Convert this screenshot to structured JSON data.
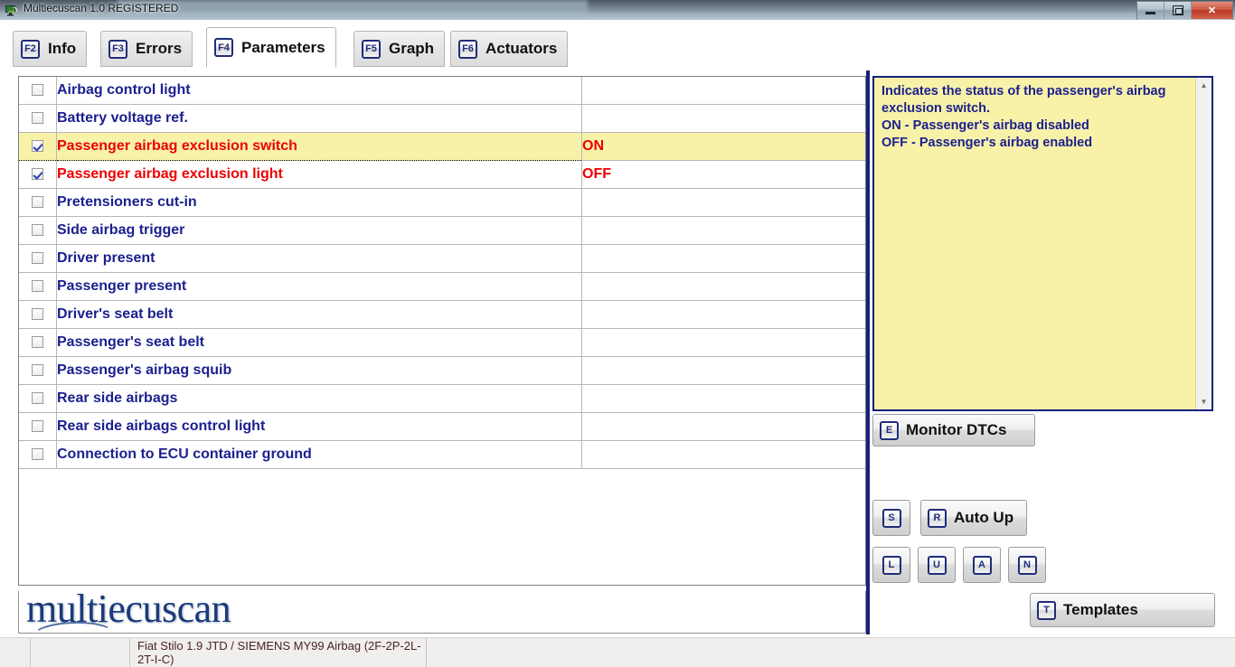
{
  "window": {
    "title": "Multiecuscan 1.0 REGISTERED",
    "app_icon": "car-scanner-icon",
    "minimize_label": "–",
    "restore_label": "❐",
    "close_label": "✕"
  },
  "tabs": [
    {
      "key": "F2",
      "label": "Info",
      "active": false
    },
    {
      "key": "F3",
      "label": "Errors",
      "active": false
    },
    {
      "key": "F4",
      "label": "Parameters",
      "active": true
    },
    {
      "key": "F5",
      "label": "Graph",
      "active": false
    },
    {
      "key": "F6",
      "label": "Actuators",
      "active": false
    }
  ],
  "grid": {
    "rows": [
      {
        "checked": false,
        "selected": false,
        "alert": false,
        "name": "Airbag control light",
        "value": ""
      },
      {
        "checked": false,
        "selected": false,
        "alert": false,
        "name": "Battery voltage ref.",
        "value": ""
      },
      {
        "checked": true,
        "selected": true,
        "alert": true,
        "name": "Passenger airbag exclusion switch",
        "value": "ON"
      },
      {
        "checked": true,
        "selected": false,
        "alert": true,
        "name": "Passenger airbag exclusion light",
        "value": "OFF"
      },
      {
        "checked": false,
        "selected": false,
        "alert": false,
        "name": "Pretensioners cut-in",
        "value": ""
      },
      {
        "checked": false,
        "selected": false,
        "alert": false,
        "name": "Side airbag trigger",
        "value": ""
      },
      {
        "checked": false,
        "selected": false,
        "alert": false,
        "name": "Driver present",
        "value": ""
      },
      {
        "checked": false,
        "selected": false,
        "alert": false,
        "name": "Passenger present",
        "value": ""
      },
      {
        "checked": false,
        "selected": false,
        "alert": false,
        "name": "Driver's seat belt",
        "value": ""
      },
      {
        "checked": false,
        "selected": false,
        "alert": false,
        "name": "Passenger's seat belt",
        "value": ""
      },
      {
        "checked": false,
        "selected": false,
        "alert": false,
        "name": "Passenger's airbag squib",
        "value": ""
      },
      {
        "checked": false,
        "selected": false,
        "alert": false,
        "name": "Rear side airbags",
        "value": ""
      },
      {
        "checked": false,
        "selected": false,
        "alert": false,
        "name": "Rear side airbags control light",
        "value": ""
      },
      {
        "checked": false,
        "selected": false,
        "alert": false,
        "name": "Connection to ECU container ground",
        "value": ""
      }
    ]
  },
  "help": {
    "text": "Indicates the status of the passenger's airbag exclusion switch.\nON - Passenger's airbag disabled\nOFF - Passenger's airbag enabled",
    "scroll_up_glyph": "▲",
    "scroll_down_glyph": "▼"
  },
  "buttons": {
    "monitor_dtcs": {
      "key": "E",
      "label": "Monitor DTCs"
    },
    "save": {
      "key": "S",
      "label": ""
    },
    "auto_up": {
      "key": "R",
      "label": "Auto Up"
    },
    "load": {
      "key": "L",
      "label": ""
    },
    "up": {
      "key": "U",
      "label": ""
    },
    "a": {
      "key": "A",
      "label": ""
    },
    "n": {
      "key": "N",
      "label": ""
    },
    "templates": {
      "key": "T",
      "label": "Templates"
    }
  },
  "branding": {
    "logo_text": "multiecuscan"
  },
  "statusbar": {
    "cell1": "",
    "cell2": "",
    "vehicle": "Fiat Stilo 1.9 JTD / SIEMENS MY99 Airbag (2F-2P-2L-2T-I-C)"
  },
  "colors": {
    "accent_blue": "#16207d",
    "label_blue": "#1b1f8f",
    "alert_red": "#ee0000",
    "highlight_yellow": "#f7f2a8"
  }
}
